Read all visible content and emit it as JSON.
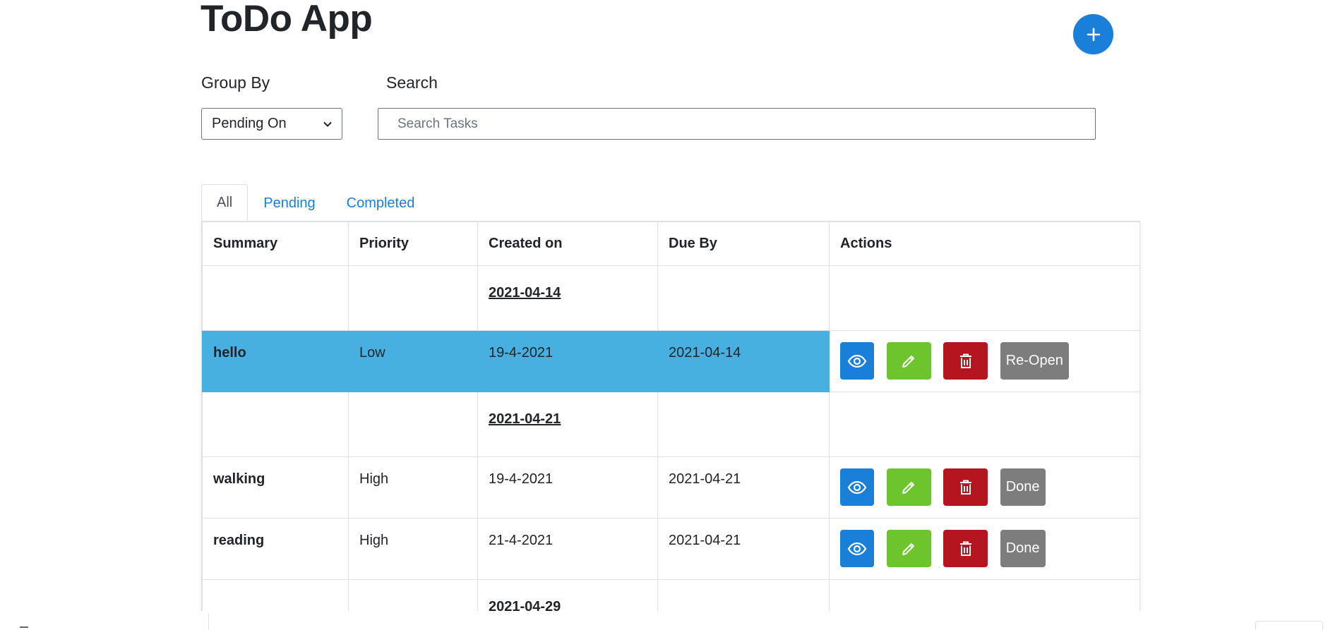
{
  "header": {
    "title": "ToDo App",
    "add_icon": "plus-icon"
  },
  "filters": {
    "group_by_label": "Group By",
    "group_by_selected": "Pending On",
    "search_label": "Search",
    "search_placeholder": "Search Tasks",
    "search_value": ""
  },
  "tabs": [
    {
      "label": "All",
      "active": true
    },
    {
      "label": "Pending",
      "active": false
    },
    {
      "label": "Completed",
      "active": false
    }
  ],
  "table": {
    "columns": [
      "Summary",
      "Priority",
      "Created on",
      "Due By",
      "Actions"
    ],
    "groups": [
      {
        "date": "2021-04-14",
        "rows": [
          {
            "summary": "hello",
            "priority": "Low",
            "created": "19-4-2021",
            "due": "2021-04-14",
            "toggle_label": "Re-Open",
            "selected": true
          }
        ]
      },
      {
        "date": "2021-04-21",
        "rows": [
          {
            "summary": "walking",
            "priority": "High",
            "created": "19-4-2021",
            "due": "2021-04-21",
            "toggle_label": "Done",
            "selected": false
          },
          {
            "summary": "reading",
            "priority": "High",
            "created": "21-4-2021",
            "due": "2021-04-21",
            "toggle_label": "Done",
            "selected": false
          }
        ]
      },
      {
        "date": "2021-04-29",
        "rows": []
      }
    ],
    "action_icons": {
      "view": "eye-icon",
      "edit": "pencil-icon",
      "delete": "trash-icon"
    }
  },
  "colors": {
    "primary": "#1a7fd8",
    "success": "#6cc52c",
    "danger": "#b5151e",
    "secondary": "#7d7d7d",
    "selected_row": "#48b0e0"
  }
}
